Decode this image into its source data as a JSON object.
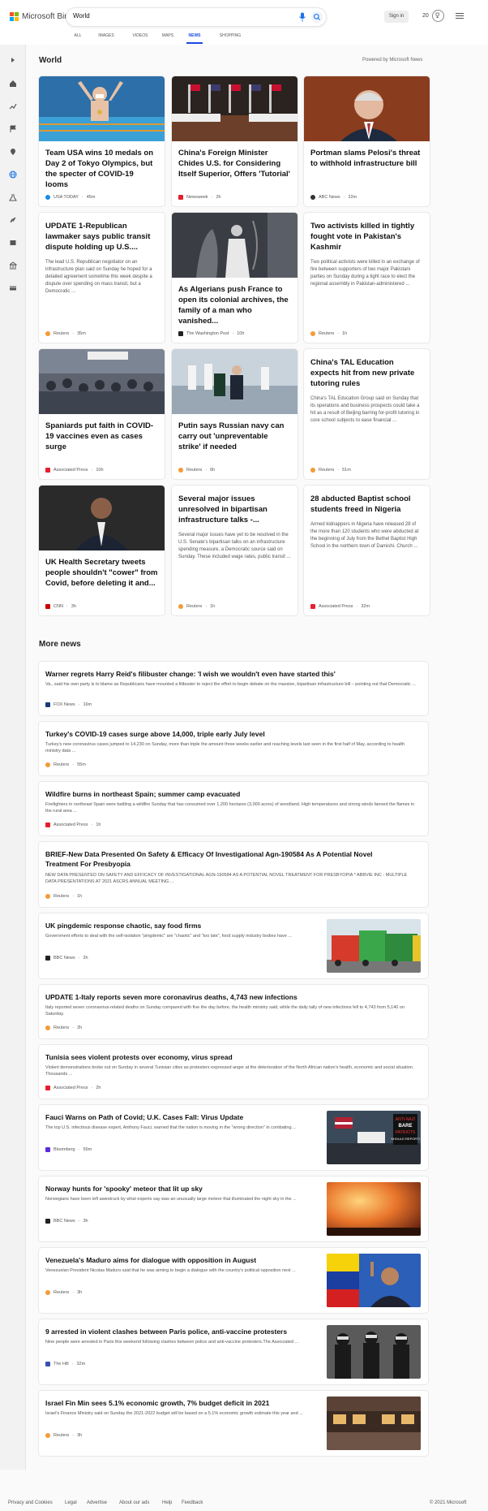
{
  "header": {
    "brand": "Microsoft Bing",
    "query": "World",
    "signin": "Sign in",
    "rewards_count": "20"
  },
  "nav_tabs": [
    "ALL",
    "IMAGES",
    "VIDEOS",
    "MAPS",
    "NEWS",
    "SHOPPING"
  ],
  "active_tab": "NEWS",
  "world": {
    "title": "World",
    "powered_by": "Powered by Microsoft News",
    "cards": [
      {
        "title": "Team USA wins 10 medals on Day 2 of Tokyo Olympics, but the specter of COVID-19 looms",
        "desc": "",
        "source": "USA TODAY",
        "time": "45m"
      },
      {
        "title": "China's Foreign Minister Chides U.S. for Considering Itself Superior, Offers 'Tutorial'",
        "desc": "",
        "source": "Newsweek",
        "time": "2h"
      },
      {
        "title": "Portman slams Pelosi's threat to withhold infrastructure bill",
        "desc": "",
        "source": "ABC News",
        "time": "22m"
      },
      {
        "title": "UPDATE 1-Republican lawmaker says public transit dispute holding up U.S....",
        "desc": "The lead U.S. Republican negotiator on an infrastructure plan said on Sunday he hoped for a detailed agreement sometime this week despite a dispute over spending on mass transit, but a Democratic ...",
        "source": "Reuters",
        "time": "35m"
      },
      {
        "title": "As Algerians push France to open its colonial archives, the family of a man who vanished...",
        "desc": "",
        "source": "The Washington Post",
        "time": "10h"
      },
      {
        "title": "Two activists killed in tightly fought vote in Pakistan's Kashmir",
        "desc": "Two political activists were killed in an exchange of fire between supporters of two major Pakistani parties on Sunday during a tight race to elect the regional assembly in Pakistan-administered ...",
        "source": "Reuters",
        "time": "1h"
      },
      {
        "title": "Spaniards put faith in COVID-19 vaccines even as cases surge",
        "desc": "",
        "source": "Associated Press",
        "time": "10h"
      },
      {
        "title": "Putin says Russian navy can carry out 'unpreventable strike' if needed",
        "desc": "",
        "source": "Reuters",
        "time": "6h"
      },
      {
        "title": "China's TAL Education expects hit from new private tutoring rules",
        "desc": "China's TAL Education Group said on Sunday that its operations and business prospects could take a hit as a result of Beijing barring for-profit tutoring in core school subjects to ease financial ...",
        "source": "Reuters",
        "time": "51m"
      },
      {
        "title": "UK Health Secretary tweets people shouldn't \"cower\" from Covid, before deleting it and...",
        "desc": "",
        "source": "CNN",
        "time": "3h"
      },
      {
        "title": "Several major issues unresolved in bipartisan infrastructure talks -...",
        "desc": "Several major issues have yet to be resolved in the U.S. Senate's bipartisan talks on an infrastructure spending measure, a Democratic source said on Sunday. These included wage rates, public transit ...",
        "source": "Reuters",
        "time": "1h"
      },
      {
        "title": "28 abducted Baptist school students freed in Nigeria",
        "desc": "Armed kidnappers in Nigeria have released 28 of the more than 120 students who were abducted at the beginning of July from the Bethel Baptist High School in the northern town of Damishi. Church ...",
        "source": "Associated Press",
        "time": "32m"
      }
    ]
  },
  "more_news": {
    "title": "More news",
    "items": [
      {
        "title": "Warner regrets Harry Reid's filibuster change: 'I wish we wouldn't even have started this'",
        "desc": "Va., said his own party is to blame as Republicans have mounted a filibuster to reject the effort to begin debate on the massive, bipartisan infrastructure bill – pointing out that Democratic ...",
        "source": "FOX News",
        "time": "16m"
      },
      {
        "title": "Turkey's COVID-19 cases surge above 14,000, triple early July level",
        "desc": "Turkey's new coronavirus cases jumped to 14,230 on Sunday, more than triple the amount three weeks earlier and reaching levels last seen in the first half of May, according to health ministry data ...",
        "source": "Reuters",
        "time": "55m"
      },
      {
        "title": "Wildfire burns in northeast Spain; summer camp evacuated",
        "desc": "Firefighters in northeast Spain were battling a wildfire Sunday that has consumed over 1,200 hectares (3,000 acres) of woodland. High temperatures and strong winds fanned the flames in the rural area ...",
        "source": "Associated Press",
        "time": "1h"
      },
      {
        "title": "BRIEF-New Data Presented On Safety & Efficacy Of Investigational Agn-190584 As A Potential Novel Treatment For Presbyopia",
        "desc": "NEW DATA PRESENTED ON SAFETY AND EFFICACY OF INVESTIGATIONAL AGN-190584 AS A POTENTIAL NOVEL TREATMENT FOR PRESBYOPIA * ABBVIE INC - MULTIPLE DATA PRESENTATIONS AT 2021 ASCRS ANNUAL MEETING ...",
        "source": "Reuters",
        "time": "1h"
      },
      {
        "title": "UK pingdemic response chaotic, say food firms",
        "desc": "Government efforts to deal with the self-isolation \"pingdemic\" are \"chaotic\" and \"too late\", food supply industry bodies have ...",
        "source": "BBC News",
        "time": "2h"
      },
      {
        "title": "UPDATE 1-Italy reports seven more coronavirus deaths, 4,743 new infections",
        "desc": "Italy reported seven coronavirus-related deaths on Sunday compared with five the day before, the health ministry said, while the daily tally of new infections fell to 4,743 from 5,140 on Saturday.",
        "source": "Reuters",
        "time": "2h"
      },
      {
        "title": "Tunisia sees violent protests over economy, virus spread",
        "desc": "Violent demonstrations broke out on Sunday in several Tunisian cities as protesters expressed anger at the deterioration of the North African nation's health, economic and social situation. Thousands ...",
        "source": "Associated Press",
        "time": "2h"
      },
      {
        "title": "Fauci Warns on Path of Covid; U.K. Cases Fall: Virus Update",
        "desc": "The top U.S. infectious disease expert, Anthony Fauci, warned that the nation is moving in the \"wrong direction\" in combating ...",
        "source": "Bloomberg",
        "time": "59m",
        "thumb_text": "ANTI-NAZI BARE PATRIOTS SHOULD REPORT!"
      },
      {
        "title": "Norway hunts for 'spooky' meteor that lit up sky",
        "desc": "Norwegians have been left awestruck by what experts say was an unusually large meteor that illuminated the night sky in the ...",
        "source": "BBC News",
        "time": "3h"
      },
      {
        "title": "Venezuela's Maduro aims for dialogue with opposition in August",
        "desc": "Venezuelan President Nicolas Maduro said that he was aiming to begin a dialogue with the country's political opposition next ...",
        "source": "Reuters",
        "time": "3h"
      },
      {
        "title": "9 arrested in violent clashes between Paris police, anti-vaccine protesters",
        "desc": "Nine people were arrested in Paris this weekend following clashes between police and anti-vaccine protesters.The Associated ...",
        "source": "The Hill",
        "time": "32m"
      },
      {
        "title": "Israel Fin Min sees 5.1% economic growth, 7% budget deficit in 2021",
        "desc": "Israel's Finance Ministry said on Sunday the 2021-2022 budget will be based on a 5.1% economic growth estimate this year and ...",
        "source": "Reuters",
        "time": "3h"
      }
    ]
  },
  "footer": {
    "links": [
      "Privacy and Cookies",
      "Legal",
      "Advertise",
      "About our ads",
      "Help",
      "Feedback"
    ],
    "copyright": "© 2021 Microsoft"
  }
}
